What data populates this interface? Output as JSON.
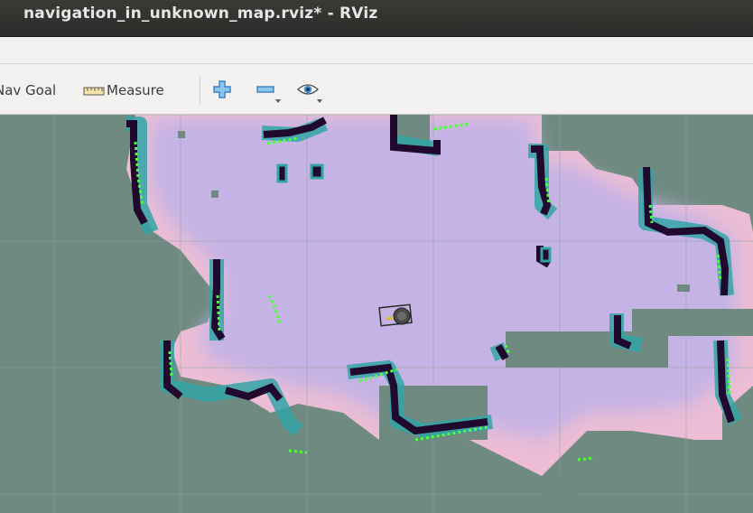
{
  "window": {
    "title": "navigation_in_unknown_map.rviz* - RViz"
  },
  "toolbar": {
    "nav_goal_label": "Nav Goal",
    "measure_label": "Measure",
    "zoom_in_icon": "plus-icon",
    "zoom_out_icon": "minus-icon",
    "view_icon": "eye-icon"
  },
  "colors": {
    "unknown": "#6f8a81",
    "free": "#c5b3e5",
    "inflation": "#ecbdd4",
    "obstacle": "#21082d",
    "inflated_edge": "#33a4a6",
    "laser": "#4dff3d",
    "grid": "#90a59e"
  }
}
